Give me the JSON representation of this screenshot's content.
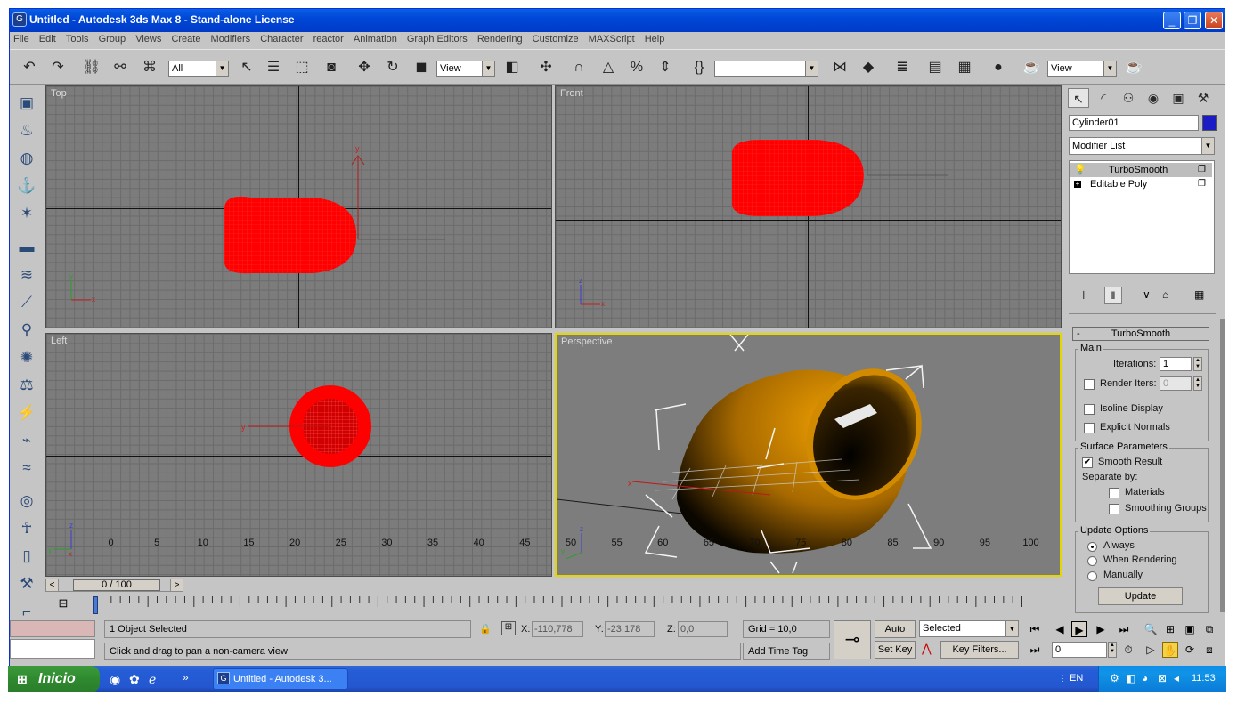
{
  "window": {
    "title": "Untitled - Autodesk 3ds Max 8  - Stand-alone License",
    "app_icon": "3ds-max-icon",
    "controls": [
      "_",
      "❐",
      "✕"
    ]
  },
  "menu": [
    "File",
    "Edit",
    "Tools",
    "Group",
    "Views",
    "Create",
    "Modifiers",
    "Character",
    "reactor",
    "Animation",
    "Graph Editors",
    "Rendering",
    "Customize",
    "MAXScript",
    "Help"
  ],
  "toolbar": {
    "selection_filter": "All",
    "ref_coord": "View",
    "named_selection": "",
    "render_view": "View"
  },
  "viewports": {
    "top": "Top",
    "front": "Front",
    "left": "Left",
    "perspective": "Perspective"
  },
  "panel": {
    "object_name": "Cylinder01",
    "object_color": "#1c1cc4",
    "modifier_list": "Modifier List",
    "stack": [
      "TurboSmooth",
      "Editable Poly"
    ],
    "rollout_title": "TurboSmooth",
    "main_group": "Main",
    "iterations_label": "Iterations:",
    "iterations_value": "1",
    "render_iters_label": "Render Iters:",
    "render_iters_value": "0",
    "isoline_display": "Isoline Display",
    "explicit_normals": "Explicit Normals",
    "surface_group": "Surface Parameters",
    "smooth_result": "Smooth Result",
    "separate_by": "Separate by:",
    "materials": "Materials",
    "smoothing_groups": "Smoothing Groups",
    "update_group": "Update Options",
    "always": "Always",
    "when_rendering": "When Rendering",
    "manually": "Manually",
    "update_button": "Update"
  },
  "timeline": {
    "slider_label": "0 / 100",
    "ticks": [
      "0",
      "5",
      "10",
      "15",
      "20",
      "25",
      "30",
      "35",
      "40",
      "45",
      "50",
      "55",
      "60",
      "65",
      "70",
      "75",
      "80",
      "85",
      "90",
      "95",
      "100"
    ]
  },
  "status": {
    "selection": "1 Object Selected",
    "prompt": "Click and drag to pan a non-camera view",
    "x_label": "X:",
    "x_value": "-110,778",
    "y_label": "Y:",
    "y_value": "-23,178",
    "z_label": "Z:",
    "z_value": "0,0",
    "grid": "Grid = 10,0",
    "add_time_tag": "Add Time Tag",
    "auto_key": "Auto Key",
    "set_key": "Set Key",
    "key_mode": "Selected",
    "key_filters": "Key Filters...",
    "frame": "0"
  },
  "taskbar": {
    "start": "Inicio",
    "task": "Untitled - Autodesk 3...",
    "lang": "EN",
    "clock": "11:53"
  },
  "colors": {
    "wire_selected": "#ff0000",
    "active_viewport_border": "#e6d600",
    "object_shade": "#c47f00"
  }
}
